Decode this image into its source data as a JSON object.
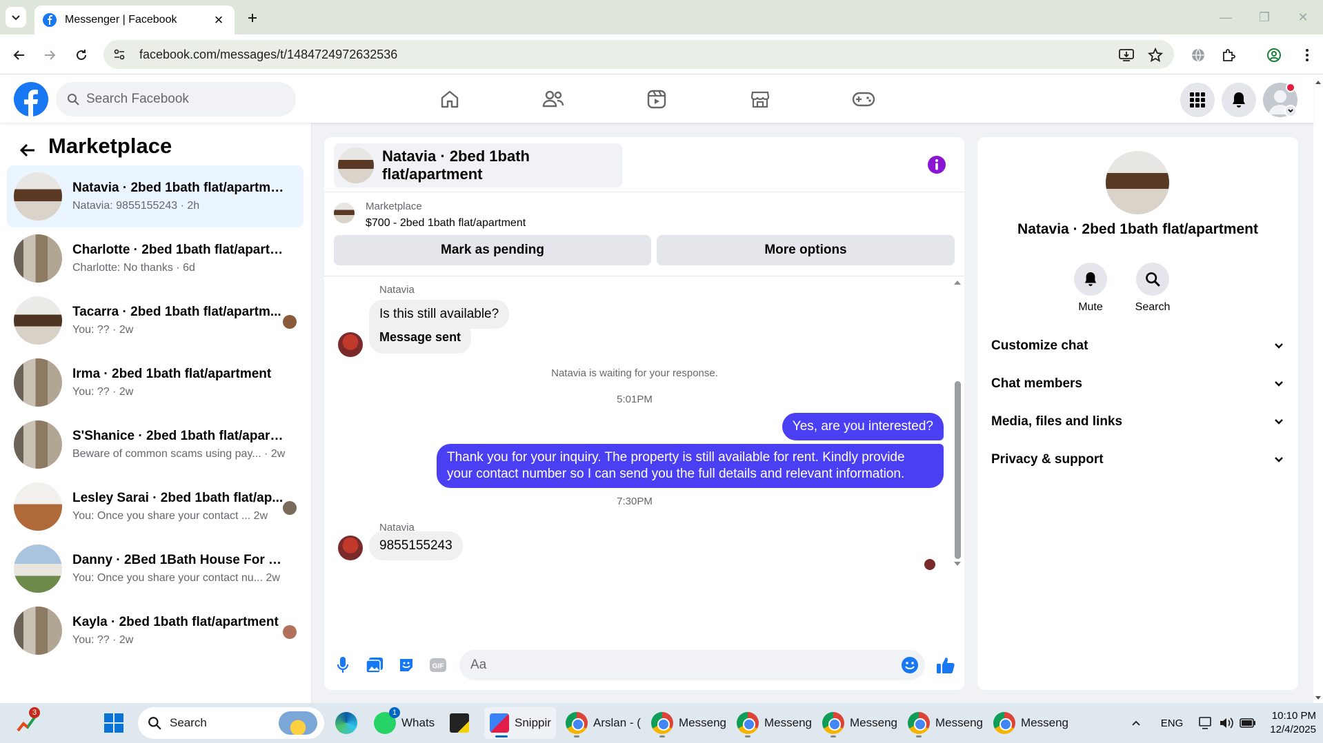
{
  "browser": {
    "tab_title": "Messenger | Facebook",
    "url": "facebook.com/messages/t/1484724972632536"
  },
  "fb": {
    "search_placeholder": "Search Facebook"
  },
  "left": {
    "title": "Marketplace",
    "conversations": [
      {
        "name": "Natavia · 2bed 1bath flat/apartment",
        "sub": "Natavia: 9855155243 · 2h"
      },
      {
        "name": "Charlotte · 2bed 1bath flat/apartm...",
        "sub": "Charlotte: No thanks · 6d"
      },
      {
        "name": "Tacarra · 2bed 1bath flat/apartm...",
        "sub": "You: ?? · 2w"
      },
      {
        "name": "Irma · 2bed 1bath flat/apartment",
        "sub": "You: ?? · 2w"
      },
      {
        "name": "S'Shanice · 2bed 1bath flat/apartm...",
        "sub": "Beware of common scams using pay...  · 2w"
      },
      {
        "name": "Lesley Sarai · 2bed 1bath flat/ap...",
        "sub": "You: Once you share your contact ...  2w"
      },
      {
        "name": "Danny · 2Bed 1Bath House For Rent",
        "sub": "You: Once you share your contact nu...  2w"
      },
      {
        "name": "Kayla · 2bed 1bath flat/apartment",
        "sub": "You: ?? · 2w"
      }
    ]
  },
  "chat": {
    "title": "Natavia · 2bed 1bath flat/apartment",
    "marketplace_label": "Marketplace",
    "listing": "$700 - 2bed 1bath flat/apartment",
    "mark_pending": "Mark as pending",
    "more_options": "More options",
    "messages": {
      "sender1": "Natavia",
      "in1": "Is this still available?",
      "in2": "Message sent",
      "waiting": "Natavia is waiting for your response.",
      "time1": "5:01PM",
      "out1": "Yes, are you interested?",
      "out2": "Thank you for your inquiry. The property is still available for rent. Kindly provide your contact number so I can send you the full details and relevant information.",
      "time2": "7:30PM",
      "sender2": "Natavia",
      "in3": "9855155243"
    },
    "input_placeholder": "Aa"
  },
  "info": {
    "name": "Natavia · 2bed 1bath flat/apartment",
    "mute": "Mute",
    "search": "Search",
    "sections": [
      "Customize chat",
      "Chat members",
      "Media, files and links",
      "Privacy & support"
    ]
  },
  "taskbar": {
    "search": "Search",
    "badge_left": "3",
    "whatsapp_badge": "1",
    "apps": [
      "Whats",
      "Snippir",
      "Arslan - (",
      "Messeng",
      "Messeng",
      "Messeng",
      "Messeng",
      "Messeng"
    ],
    "lang": "ENG",
    "time": "10:10 PM",
    "date": "12/4/2025"
  },
  "colors": {
    "fb_blue": "#1877f2",
    "outgoing_bubble": "#4b3ff3",
    "info_purple": "#8a16d4"
  },
  "icons": [
    "chevron-down-icon",
    "facebook-icon",
    "close-icon",
    "plus-icon",
    "back-icon",
    "forward-icon",
    "reload-icon",
    "site-info-icon",
    "install-icon",
    "star-icon",
    "globe-icon",
    "extensions-icon",
    "profile-icon",
    "kebab-icon",
    "search-icon",
    "home-icon",
    "friends-icon",
    "video-icon",
    "marketplace-icon",
    "gaming-icon",
    "grid-menu-icon",
    "bell-icon",
    "info-icon",
    "mic-icon",
    "photo-icon",
    "sticker-icon",
    "gif-icon",
    "emoji-icon",
    "thumbs-up-icon"
  ]
}
